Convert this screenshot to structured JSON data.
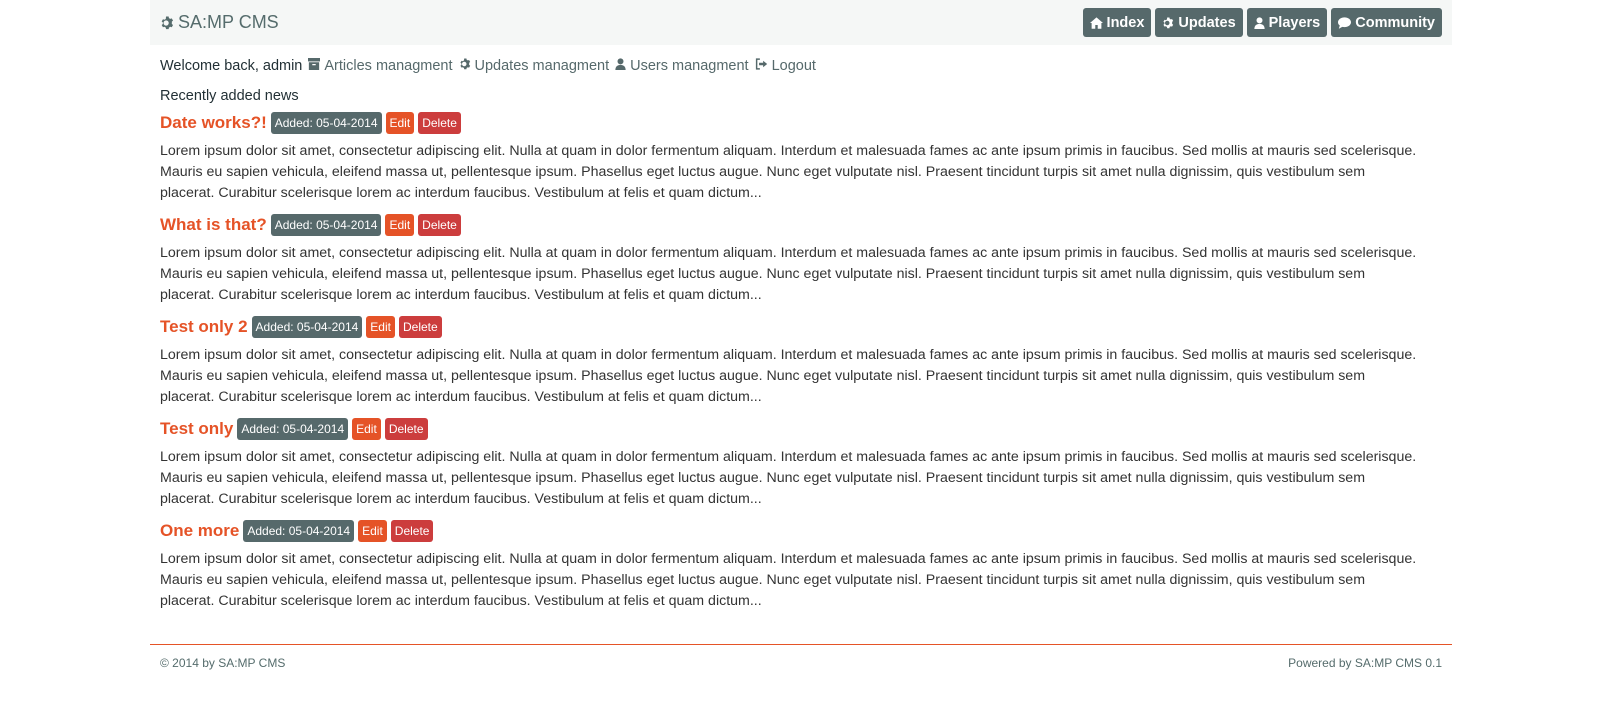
{
  "brand": {
    "title": "SA:MP CMS"
  },
  "nav": {
    "index": "Index",
    "updates": "Updates",
    "players": "Players",
    "community": "Community"
  },
  "userbar": {
    "welcome": "Welcome back, admin",
    "articles": "Articles managment",
    "updates": "Updates managment",
    "users": "Users managment",
    "logout": "Logout"
  },
  "section_title": "Recently added news",
  "articles": [
    {
      "title": "Date works?!",
      "date": "Added: 05-04-2014",
      "edit": "Edit",
      "delete": "Delete",
      "body": "Lorem ipsum dolor sit amet, consectetur adipiscing elit. Nulla at quam in dolor fermentum aliquam. Interdum et malesuada fames ac ante ipsum primis in faucibus. Sed mollis at mauris sed scelerisque. Mauris eu sapien vehicula, eleifend massa ut, pellentesque ipsum. Phasellus eget luctus augue. Nunc eget vulputate nisl. Praesent tincidunt turpis sit amet nulla dignissim, quis vestibulum sem placerat. Curabitur scelerisque lorem ac interdum faucibus. Vestibulum at felis et quam dictum..."
    },
    {
      "title": "What is that?",
      "date": "Added: 05-04-2014",
      "edit": "Edit",
      "delete": "Delete",
      "body": "Lorem ipsum dolor sit amet, consectetur adipiscing elit. Nulla at quam in dolor fermentum aliquam. Interdum et malesuada fames ac ante ipsum primis in faucibus. Sed mollis at mauris sed scelerisque. Mauris eu sapien vehicula, eleifend massa ut, pellentesque ipsum. Phasellus eget luctus augue. Nunc eget vulputate nisl. Praesent tincidunt turpis sit amet nulla dignissim, quis vestibulum sem placerat. Curabitur scelerisque lorem ac interdum faucibus. Vestibulum at felis et quam dictum..."
    },
    {
      "title": "Test only 2",
      "date": "Added: 05-04-2014",
      "edit": "Edit",
      "delete": "Delete",
      "body": "Lorem ipsum dolor sit amet, consectetur adipiscing elit. Nulla at quam in dolor fermentum aliquam. Interdum et malesuada fames ac ante ipsum primis in faucibus. Sed mollis at mauris sed scelerisque. Mauris eu sapien vehicula, eleifend massa ut, pellentesque ipsum. Phasellus eget luctus augue. Nunc eget vulputate nisl. Praesent tincidunt turpis sit amet nulla dignissim, quis vestibulum sem placerat. Curabitur scelerisque lorem ac interdum faucibus. Vestibulum at felis et quam dictum..."
    },
    {
      "title": "Test only",
      "date": "Added: 05-04-2014",
      "edit": "Edit",
      "delete": "Delete",
      "body": "Lorem ipsum dolor sit amet, consectetur adipiscing elit. Nulla at quam in dolor fermentum aliquam. Interdum et malesuada fames ac ante ipsum primis in faucibus. Sed mollis at mauris sed scelerisque. Mauris eu sapien vehicula, eleifend massa ut, pellentesque ipsum. Phasellus eget luctus augue. Nunc eget vulputate nisl. Praesent tincidunt turpis sit amet nulla dignissim, quis vestibulum sem placerat. Curabitur scelerisque lorem ac interdum faucibus. Vestibulum at felis et quam dictum..."
    },
    {
      "title": "One more",
      "date": "Added: 05-04-2014",
      "edit": "Edit",
      "delete": "Delete",
      "body": "Lorem ipsum dolor sit amet, consectetur adipiscing elit. Nulla at quam in dolor fermentum aliquam. Interdum et malesuada fames ac ante ipsum primis in faucibus. Sed mollis at mauris sed scelerisque. Mauris eu sapien vehicula, eleifend massa ut, pellentesque ipsum. Phasellus eget luctus augue. Nunc eget vulputate nisl. Praesent tincidunt turpis sit amet nulla dignissim, quis vestibulum sem placerat. Curabitur scelerisque lorem ac interdum faucibus. Vestibulum at felis et quam dictum..."
    }
  ],
  "footer": {
    "copyright": "© 2014 by SA:MP CMS",
    "powered": "Powered by SA:MP CMS 0.1"
  },
  "colors": {
    "accent": "#e55327",
    "nav_button": "#56696b",
    "danger": "#cc3d3d"
  },
  "icons": {
    "brand": "gear-icon",
    "index": "home-icon",
    "updates": "gear-icon",
    "players": "user-icon",
    "community": "comment-icon",
    "articles": "archive-icon",
    "logout": "sign-out-icon"
  }
}
